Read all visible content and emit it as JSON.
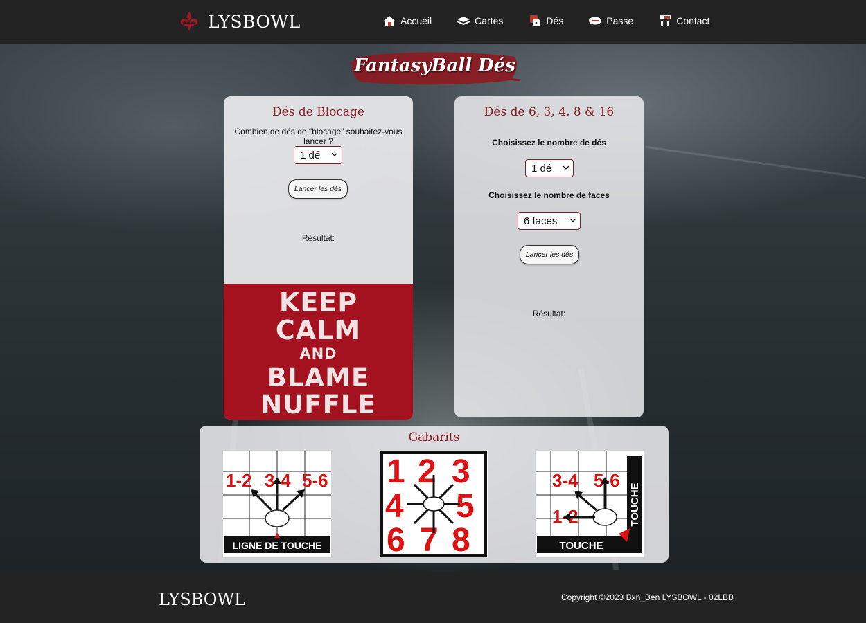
{
  "brand": {
    "name": "LYSBOWL"
  },
  "nav": [
    {
      "label": "Accueil",
      "icon": "home-icon"
    },
    {
      "label": "Cartes",
      "icon": "cards-icon"
    },
    {
      "label": "Dés",
      "icon": "dice-icon"
    },
    {
      "label": "Passe",
      "icon": "football-icon"
    },
    {
      "label": "Contact",
      "icon": "contact-icon"
    }
  ],
  "page_title": "FantasyBall Dés",
  "block_dice": {
    "title": "Dés de Blocage",
    "question": "Combien de dés de \"blocage\" souhaitez-vous lancer ?",
    "select_value": "1 dé",
    "button": "Lancer les dés",
    "result_label": "Résultat:",
    "poster": {
      "line1": "KEEP",
      "line2": "CALM",
      "line3": "AND",
      "line4": "BLAME",
      "line5": "NUFFLE"
    }
  },
  "multi_dice": {
    "title": "Dés de 6, 3, 4, 8 & 16",
    "count_label": "Choisissez le nombre de dés",
    "count_value": "1 dé",
    "faces_label": "Choisissez le nombre de faces",
    "faces_value": "6 faces",
    "button": "Lancer les dés",
    "result_label": "Résultat:"
  },
  "templates": {
    "title": "Gabarits",
    "items": [
      {
        "name": "ligne-de-touche",
        "labels": [
          "1-2",
          "3-4",
          "5-6"
        ],
        "caption": "LIGNE DE TOUCHE"
      },
      {
        "name": "scatter",
        "labels": [
          "1",
          "2",
          "3",
          "4",
          "5",
          "6",
          "7",
          "8"
        ]
      },
      {
        "name": "touche-corner",
        "labels": [
          "3-4",
          "5-6",
          "1-2"
        ],
        "caption": "TOUCHE",
        "side_caption": "TOUCHE"
      }
    ]
  },
  "footer": {
    "brand": "LYSBOWL",
    "copyright": "Copyright ©2023 Bxn_Ben LYSBOWL - 02LBB"
  },
  "colors": {
    "accent": "#8c1a22",
    "poster_red": "#a5121f",
    "bar": "#232323"
  }
}
